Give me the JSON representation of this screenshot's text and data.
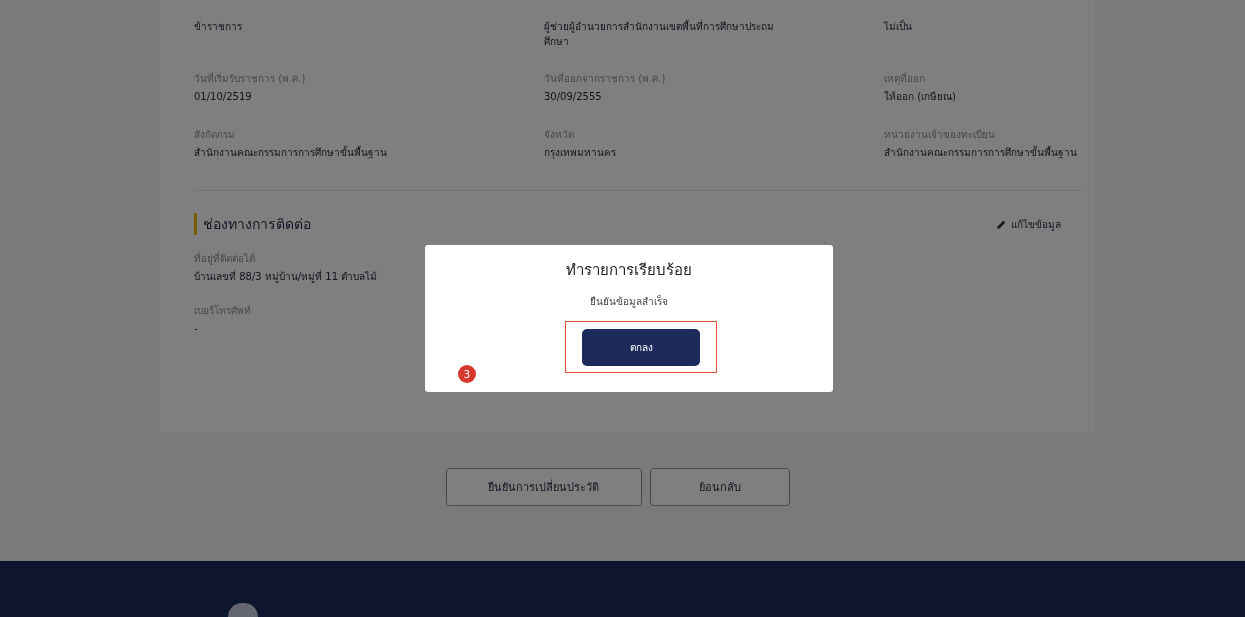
{
  "profile": {
    "rows": [
      [
        {
          "value": "ข้าราชการ"
        },
        {
          "value": "ผู้ช่วยผู้อำนวยการสำนักงานเขตพื้นที่การศึกษาประถมศึกษา"
        },
        {
          "value": "ไม่เป็น"
        }
      ],
      [
        {
          "label": "วันที่เริ่มรับราชการ (พ.ศ.)",
          "value": "01/10/2519"
        },
        {
          "label": "วันที่ออกจากราชการ (พ.ศ.)",
          "value": "30/09/2555"
        },
        {
          "label": "เหตุที่ออก",
          "value": "ให้ออก (เกษียณ)"
        }
      ],
      [
        {
          "label": "สังกัดกรม",
          "value": "สำนักงานคณะกรรมการการศึกษาขั้นพื้นฐาน"
        },
        {
          "label": "จังหวัด",
          "value": "กรุงเทพมหานคร"
        },
        {
          "label": "หน่วยงานเจ้าของทะเบียน",
          "value": "สำนักงานคณะกรรมการการศึกษาขั้นพื้นฐาน"
        }
      ]
    ]
  },
  "contact": {
    "title": "ช่องทางการติดต่อ",
    "edit_label": "แก้ไขข้อมูล",
    "fields": [
      {
        "label": "ที่อยู่ที่ติดต่อได้",
        "value": "บ้านเลขที่ 88/3 หมู่บ้าน/หมู่ที่ 11 ตำบลไม้"
      },
      {
        "label": "เบอร์โทรศัพท์",
        "value": "-"
      }
    ]
  },
  "actions": [
    "ยืนยันการเปลี่ยนประวัติ",
    "ย้อนกลับ"
  ],
  "dialog": {
    "title": "ทำรายการเรียบร้อย",
    "message": "ยืนยันข้อมูลสำเร็จ",
    "button": "ตกลง",
    "step_badge": "3"
  }
}
